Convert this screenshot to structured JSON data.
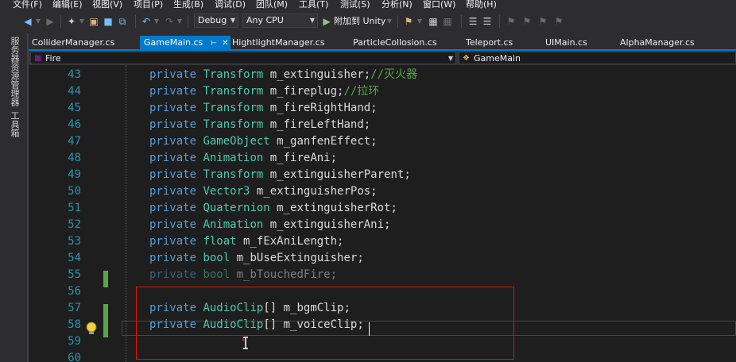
{
  "menu": [
    "文件(F)",
    "编辑(E)",
    "视图(V)",
    "项目(P)",
    "生成(B)",
    "调试(D)",
    "团队(M)",
    "工具(T)",
    "测试(S)",
    "分析(N)",
    "窗口(W)",
    "帮助(H)"
  ],
  "toolbar": {
    "configuration": "Debug",
    "platform": "Any CPU",
    "attach_label": "附加到 Unity"
  },
  "side_panels": [
    "服务器资源管理器",
    "工具箱"
  ],
  "tabs": [
    {
      "label": "ColliderManager.cs",
      "active": false
    },
    {
      "label": "GameMain.cs",
      "active": true
    },
    {
      "label": "HightlightManager.cs",
      "active": false
    },
    {
      "label": "ParticleCollosion.cs",
      "active": false
    },
    {
      "label": "Teleport.cs",
      "active": false
    },
    {
      "label": "UIMain.cs",
      "active": false
    },
    {
      "label": "AlphaManager.cs",
      "active": false
    }
  ],
  "nav": {
    "left": "Fire",
    "right": "GameMain"
  },
  "editor": {
    "lines": [
      {
        "n": "43",
        "kw": "private",
        "type": "Transform",
        "rest": " m_extinguisher;",
        "comment": "//灭火器"
      },
      {
        "n": "44",
        "kw": "private",
        "type": "Transform",
        "rest": " m_fireplug;",
        "comment": "//拉环"
      },
      {
        "n": "45",
        "kw": "private",
        "type": "Transform",
        "rest": " m_fireRightHand;",
        "comment": ""
      },
      {
        "n": "46",
        "kw": "private",
        "type": "Transform",
        "rest": " m_fireLeftHand;",
        "comment": ""
      },
      {
        "n": "47",
        "kw": "private",
        "type": "GameObject",
        "rest": " m_ganfenEffect;",
        "comment": ""
      },
      {
        "n": "48",
        "kw": "private",
        "type": "Animation",
        "rest": " m_fireAni;",
        "comment": ""
      },
      {
        "n": "49",
        "kw": "private",
        "type": "Transform",
        "rest": " m_extinguisherParent;",
        "comment": ""
      },
      {
        "n": "50",
        "kw": "private",
        "type": "Vector3",
        "rest": " m_extinguisherPos;",
        "comment": ""
      },
      {
        "n": "51",
        "kw": "private",
        "type": "Quaternion",
        "rest": " m_extinguisherRot;",
        "comment": ""
      },
      {
        "n": "52",
        "kw": "private",
        "type": "Animation",
        "rest": " m_extinguisherAni;",
        "comment": ""
      },
      {
        "n": "53",
        "kw": "private",
        "type": "float",
        "rest": " m_fExAniLength;",
        "comment": ""
      },
      {
        "n": "54",
        "kw": "private",
        "type": "bool",
        "rest": " m_bUseExtinguisher;",
        "comment": ""
      },
      {
        "n": "55",
        "kw": "private",
        "type": "bool",
        "rest": " m_bTouchedFire;",
        "comment": ""
      },
      {
        "n": "56",
        "kw": "",
        "type": "",
        "rest": "",
        "comment": ""
      },
      {
        "n": "57",
        "kw": "private",
        "type": "AudioClip",
        "rest": "[] m_bgmClip;",
        "comment": ""
      },
      {
        "n": "58",
        "kw": "private",
        "type": "AudioClip",
        "rest": "[] m_voiceClip;",
        "comment": ""
      },
      {
        "n": "59",
        "kw": "",
        "type": "",
        "rest": "",
        "comment": ""
      },
      {
        "n": "60",
        "kw": "",
        "type": "",
        "rest": "",
        "comment": ""
      }
    ]
  },
  "colors": {
    "accent": "#007acc",
    "keyword": "#569cd6",
    "type": "#4ec9b0",
    "comment": "#57a64a",
    "line_number": "#2b91af",
    "highlight_box": "#e51400"
  },
  "icons": [
    "back-icon",
    "forward-icon",
    "new-project-icon",
    "open-folder-icon",
    "save-icon",
    "save-all-icon",
    "undo-icon",
    "redo-icon",
    "start-icon",
    "lightbulb-icon"
  ]
}
